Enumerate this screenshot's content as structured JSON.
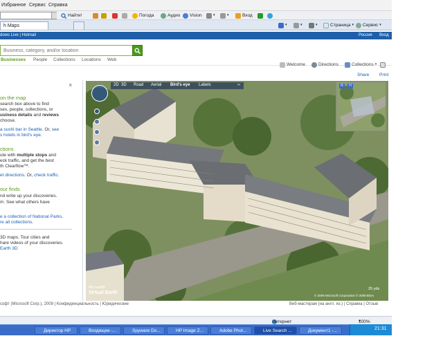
{
  "menubar": {
    "favorites": "Избранное",
    "tools": "Сервис",
    "help": "Справка"
  },
  "toolbar": {
    "find_label": "Найти!",
    "weather": "Погода",
    "audio": "Аудио",
    "vision": "Vision",
    "login": "Вход"
  },
  "tabs": {
    "current_tab": "h Maps"
  },
  "command_bar": {
    "page": "Страница",
    "service": "Сервис"
  },
  "site_bar": {
    "left": "dows Live | Hotmail",
    "lang": "Россия",
    "signin": "Вход"
  },
  "search": {
    "placeholder": "Business, category, and/or location"
  },
  "nav_links": [
    "Businesses",
    "People",
    "Collections",
    "Locations",
    "Web"
  ],
  "actions": {
    "welcome": "Welcome",
    "directions": "Directions",
    "collections": "Collections",
    "share": "Share",
    "print": "Print"
  },
  "left_panel": {
    "close": "×",
    "h1": "on the map",
    "p1a": "search box above to find",
    "p1b": "ses, people, collections, or",
    "p1c_pre": "usiness details",
    "p1c_mid": " and ",
    "p1c_bold": "reviews",
    "p1d": "choose.",
    "p2a_link": "a sushi bar in Seattle",
    "p2a_post": ". Or, ",
    "p2a_link2": "see",
    "p2b_link": "s hotels in bird's eye",
    "p2b_post": ".",
    "h2": "ctions",
    "p3a_pre": "ute with ",
    "p3a_bold": "multiple stops",
    "p3a_post": " and",
    "p3b": "eck traffic, and get the best",
    "p3c": "th Clearflow™.",
    "p4_link": "et directions",
    "p4_mid": ". Or, ",
    "p4_link2": "check traffic",
    "p4_post": ".",
    "h3": "our finds",
    "p5a": "nd write up your discoveries.",
    "p5b": "m. See what others have",
    "p6a_link": "e a collection of National Parks",
    "p6a_post": ".",
    "p6b_link": "re all collections",
    "p6b_post": ".",
    "p7a": "3D maps. Tour cities and",
    "p7b": "hare videos of your discoveries.",
    "p7c_link": "Earth 3D"
  },
  "map": {
    "modes": [
      "2D",
      "3D",
      "Road",
      "Aerial",
      "Bird's eye",
      "Labels"
    ],
    "active_mode": "Bird's eye",
    "minimap_btns": [
      "R",
      "H"
    ],
    "logo": "Virtual Earth",
    "logo_small": "Microsoft®",
    "copyright": "© 2009 Microsoft Corporation   © 2008 Blom",
    "scale": "25 yds"
  },
  "footer": {
    "left": "сoфт (Microsoft Corp.), 2009  |  Конфиденциальность  |  Юридические",
    "right": "Веб-мастерам (на англ. яз.)  |  Справка  |  Отзыв"
  },
  "status": {
    "zone": "Интернет",
    "zoom": "100%"
  },
  "taskbar": {
    "items": [
      "Директор HP",
      "Входящие -...",
      "Spyware Do...",
      "HP Image Z...",
      "Adobe Phot...",
      "Live Search ...",
      "Документ1 -..."
    ],
    "active": "Live Search ...",
    "clock": "21:31"
  },
  "colors": {
    "brand_blue": "#1e5fa8",
    "green": "#5a9a1c",
    "link": "#1a5fb4"
  }
}
